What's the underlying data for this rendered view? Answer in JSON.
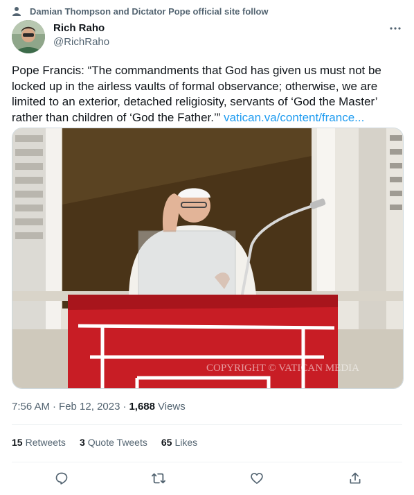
{
  "social_context": {
    "text": "Damian Thompson and Dictator Pope official site follow",
    "icon": "person-icon"
  },
  "author": {
    "display_name": "Rich Raho",
    "handle": "@RichRaho",
    "avatar_icon": "avatar"
  },
  "more_icon": "more-icon",
  "tweet": {
    "text": "Pope Francis: “The commandments that God has given us must not be locked up in the airless vaults of formal observance; otherwise, we are limited to an exterior, detached religiosity, servants of ‘God the Master’ rather than children of ‘God the Father.’” ",
    "link": "vatican.va/content/france...",
    "image_watermark": "COPYRIGHT © VATICAN MEDIA"
  },
  "meta": {
    "time": "7:56 AM",
    "separator": "·",
    "date": "Feb 12, 2023",
    "separator2": "·",
    "views_count": "1,688",
    "views_label": "Views"
  },
  "stats": [
    {
      "count": "15",
      "label": "Retweets"
    },
    {
      "count": "3",
      "label": "Quote Tweets"
    },
    {
      "count": "65",
      "label": "Likes"
    }
  ],
  "actions": [
    "reply-icon",
    "retweet-icon",
    "like-icon",
    "share-icon"
  ],
  "colors": {
    "link": "#1d9bf0",
    "secondary_text": "#536471",
    "primary_text": "#0f1419",
    "drape_red": "#c81d25"
  }
}
